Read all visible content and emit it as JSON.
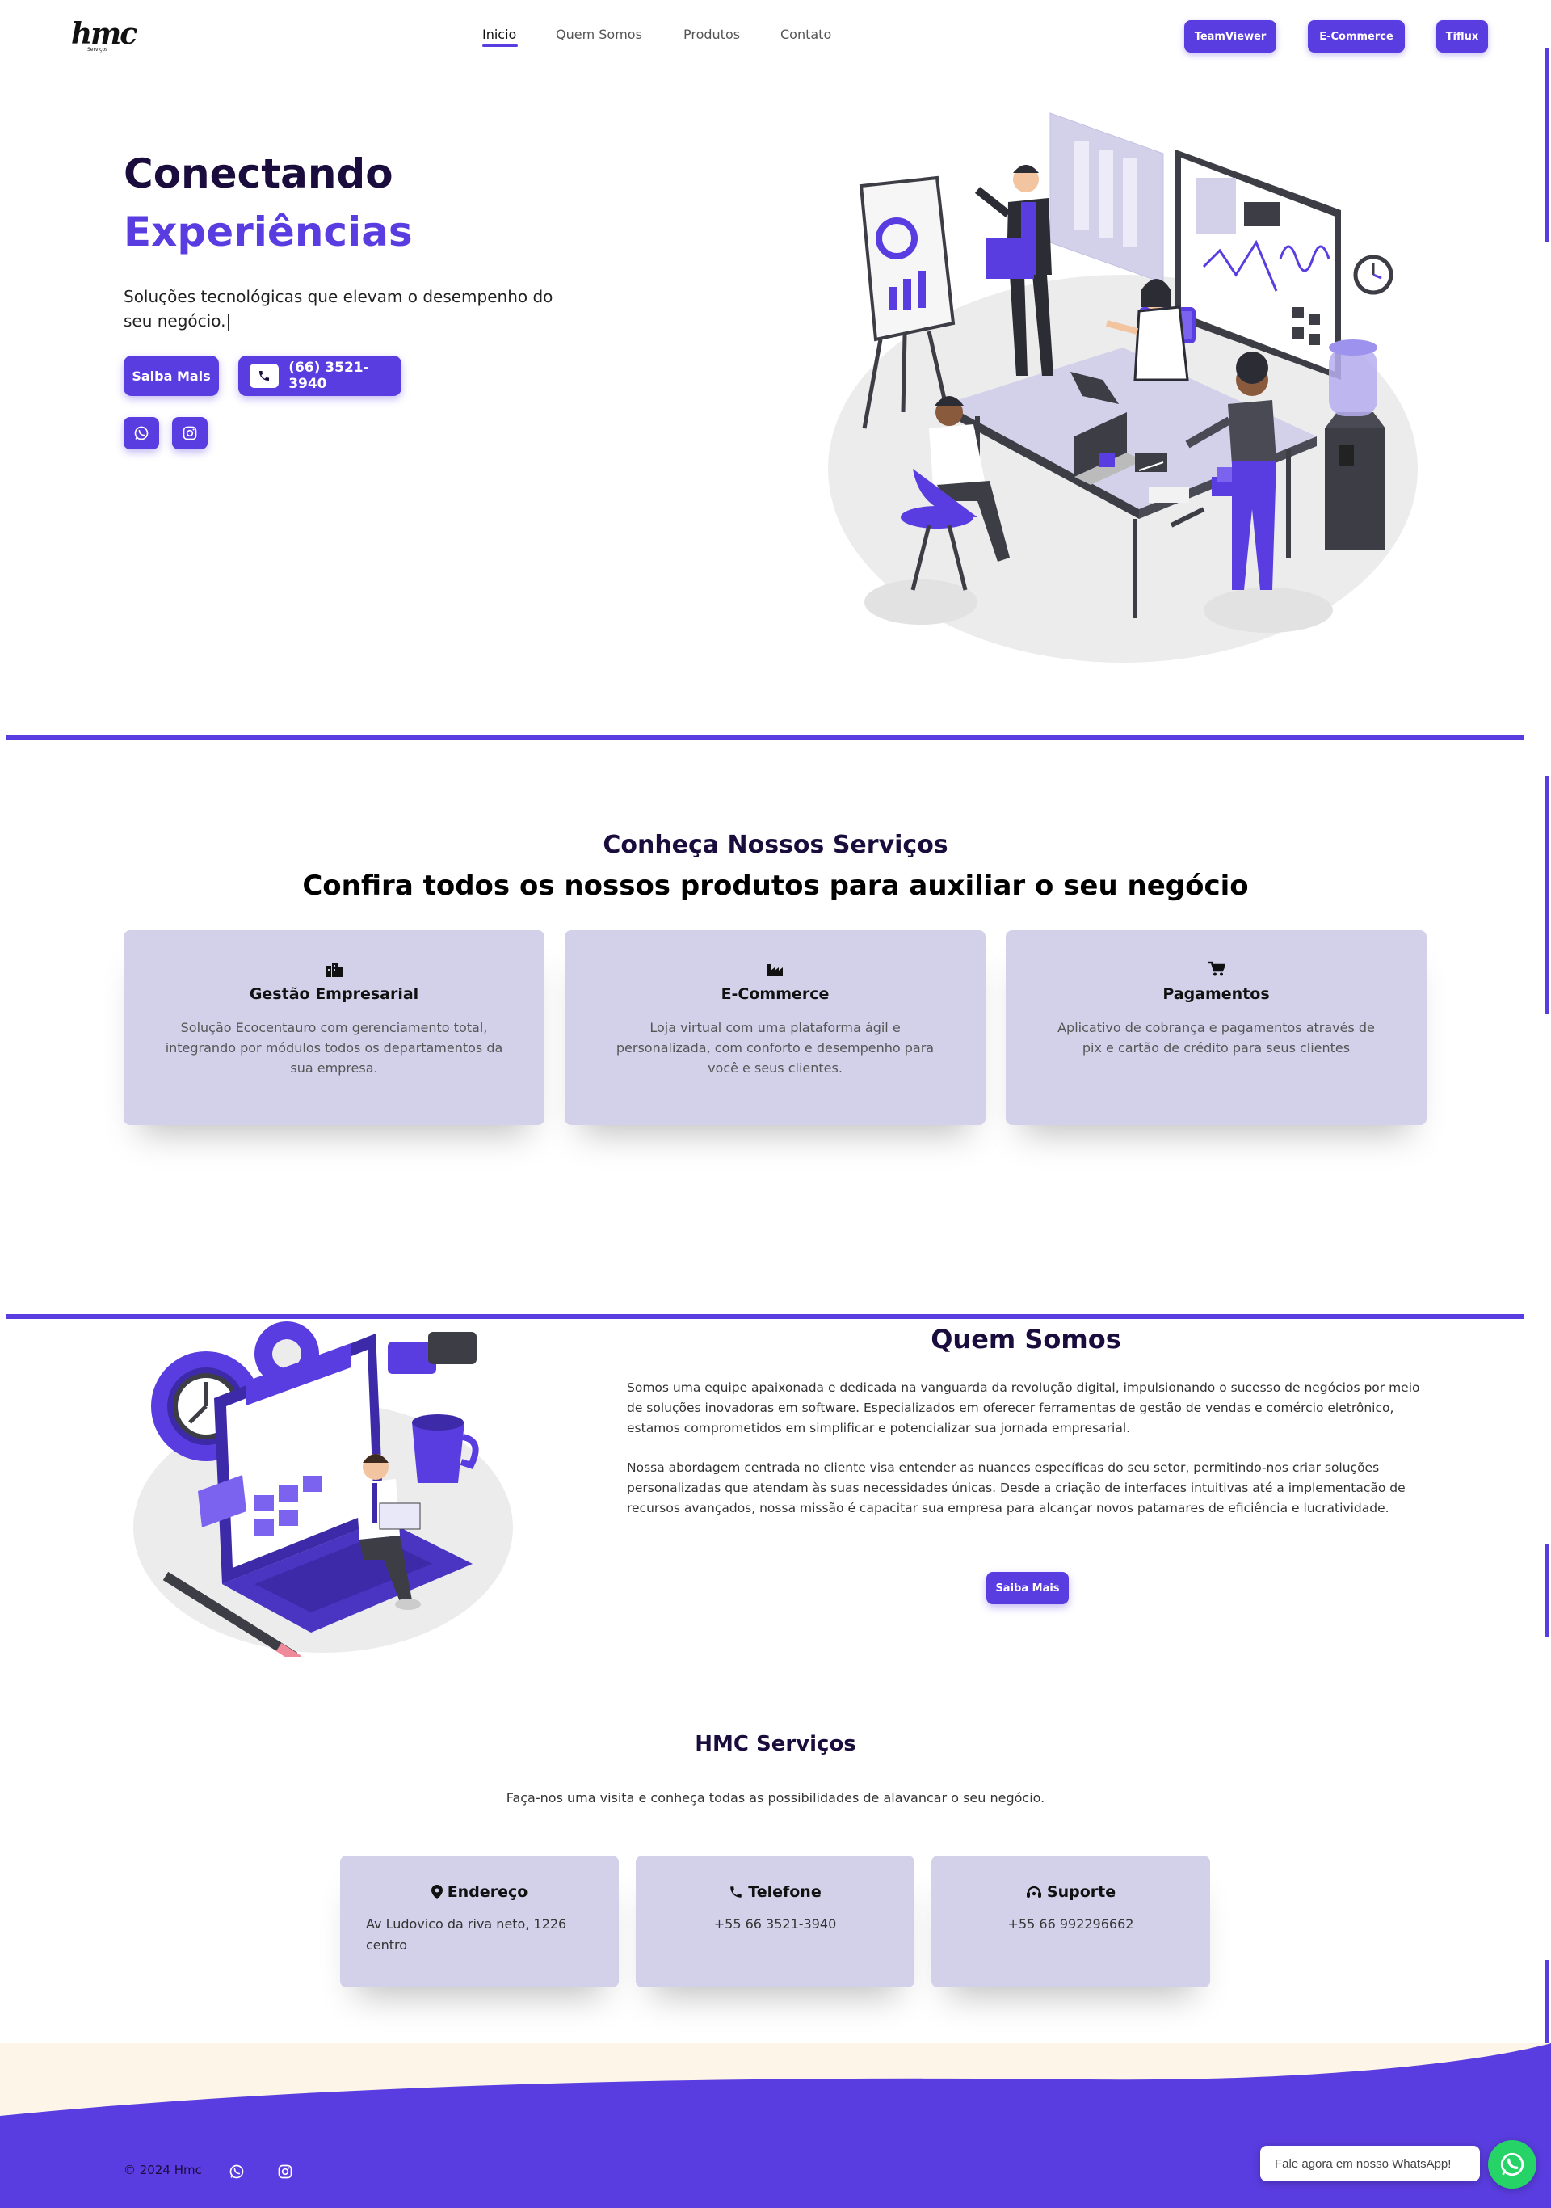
{
  "nav": {
    "logo": "hmc",
    "logo_sub": "Serviços",
    "links": [
      "Inicio",
      "Quem Somos",
      "Produtos",
      "Contato"
    ],
    "buttons": [
      "TeamViewer",
      "E-Commerce",
      "Tiflux"
    ]
  },
  "hero": {
    "title_line1": "Conectando",
    "title_line2": "Experiências",
    "subtitle": "Soluções tecnológicas que elevam o desempenho do seu negócio.|",
    "cta_label": "Saiba Mais",
    "phone_label": "(66) 3521-3940"
  },
  "services": {
    "kicker": "Conheça Nossos Serviços",
    "heading": "Confira todos os nossos produtos para auxiliar o seu negócio",
    "cards": [
      {
        "icon": "building-icon",
        "title": "Gestão Empresarial",
        "text": "Solução Ecocentauro com gerenciamento total, integrando por módulos todos os departamentos da sua empresa."
      },
      {
        "icon": "industry-icon",
        "title": "E-Commerce",
        "text": "Loja virtual com uma plataforma ágil e personalizada, com conforto e desempenho para você e seus clientes."
      },
      {
        "icon": "cart-icon",
        "title": "Pagamentos",
        "text": "Aplicativo de cobrança e pagamentos através de pix e cartão de crédito para seus clientes"
      }
    ]
  },
  "about": {
    "title": "Quem Somos",
    "p1": "Somos uma equipe apaixonada e dedicada na vanguarda da revolução digital, impulsionando o sucesso de negócios por meio de soluções inovadoras em software. Especializados em oferecer ferramentas de gestão de vendas e comércio eletrônico, estamos comprometidos em simplificar e potencializar sua jornada empresarial.",
    "p2": "Nossa abordagem centrada no cliente visa entender as nuances específicas do seu setor, permitindo-nos criar soluções personalizadas que atendam às suas necessidades únicas. Desde a criação de interfaces intuitivas até a implementação de recursos avançados, nossa missão é capacitar sua empresa para alcançar novos patamares de eficiência e lucratividade.",
    "cta_label": "Saiba Mais"
  },
  "contact": {
    "title": "HMC Serviços",
    "subtitle": "Faça-nos uma visita e conheça todas as possibilidades de alavancar o seu negócio.",
    "cards": [
      {
        "icon": "map-pin-icon",
        "title": "Endereço",
        "lines": [
          "Av Ludovico da riva neto, 1226",
          "centro"
        ]
      },
      {
        "icon": "phone-icon",
        "title": "Telefone",
        "lines": [
          "+55 66 3521-3940"
        ]
      },
      {
        "icon": "headset-icon",
        "title": "Suporte",
        "lines": [
          "+55 66 992296662"
        ]
      }
    ]
  },
  "footer": {
    "copyright": "© 2024 Hmc",
    "whatsapp_prompt": "Fale agora em nosso WhatsApp!"
  },
  "colors": {
    "accent": "#5a3de0",
    "dark": "#1a0d3d",
    "card": "#d3d1ea",
    "footer_wave_light": "#fdf6e8",
    "whatsapp": "#25d366"
  }
}
